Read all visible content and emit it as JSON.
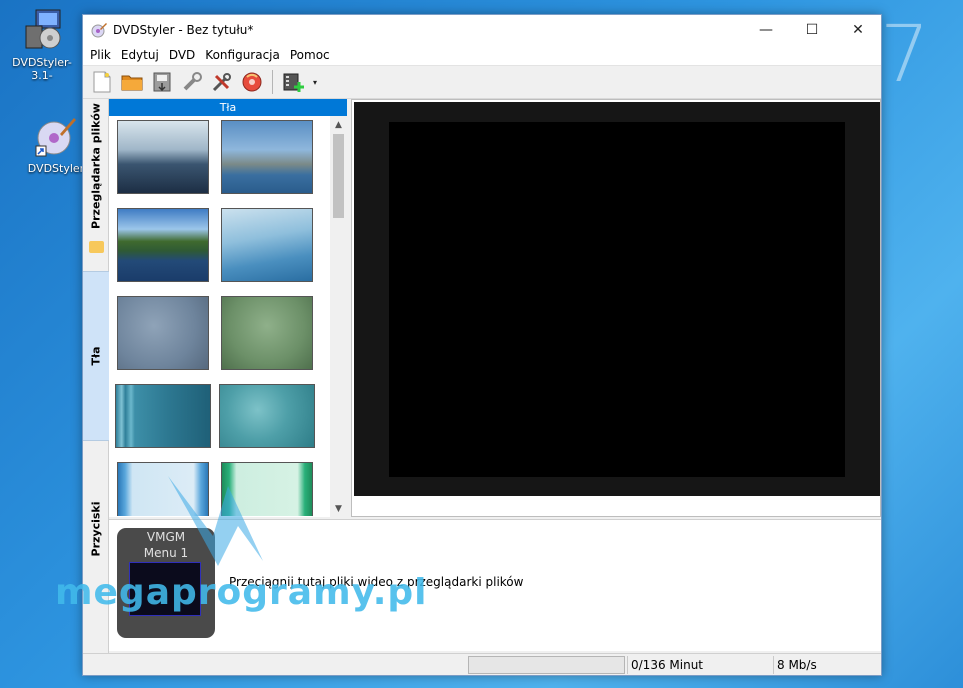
{
  "desktop": {
    "icons": [
      {
        "label": "DVDStyler-3.1-",
        "icon": "installer-icon"
      },
      {
        "label": "DVDStyler",
        "icon": "dvdstyler-shortcut-icon"
      }
    ],
    "corner_digit": "7"
  },
  "window": {
    "title": "DVDStyler - Bez tytułu*",
    "controls": {
      "minimize": "—",
      "maximize": "☐",
      "close": "✕"
    }
  },
  "menu": [
    "Plik",
    "Edytuj",
    "DVD",
    "Konfiguracja",
    "Pomoc"
  ],
  "toolbar": {
    "buttons": [
      "new-project-icon",
      "open-folder-icon",
      "save-icon",
      "settings-icon",
      "tools-icon",
      "burn-disc-icon",
      "add-video-icon"
    ],
    "dropdown_arrow": "▾"
  },
  "side_tabs": [
    "Przeglądarka plików",
    "Tła",
    "Przyciski"
  ],
  "backgrounds_panel": {
    "header": "Tła",
    "scroll_up": "▲",
    "scroll_down": "▼"
  },
  "titleset": {
    "vmgm_label": "VMGM",
    "menu_label": "Menu 1",
    "drop_hint": "Przeciągnij tutaj pliki wideo z przeglądarki plików"
  },
  "status": {
    "minutes": "0/136 Minut",
    "bitrate": "8 Mb/s"
  },
  "watermark": "megaprogramy.pl",
  "colors": {
    "accent": "#0078d7",
    "preview_bg": "#161616"
  }
}
